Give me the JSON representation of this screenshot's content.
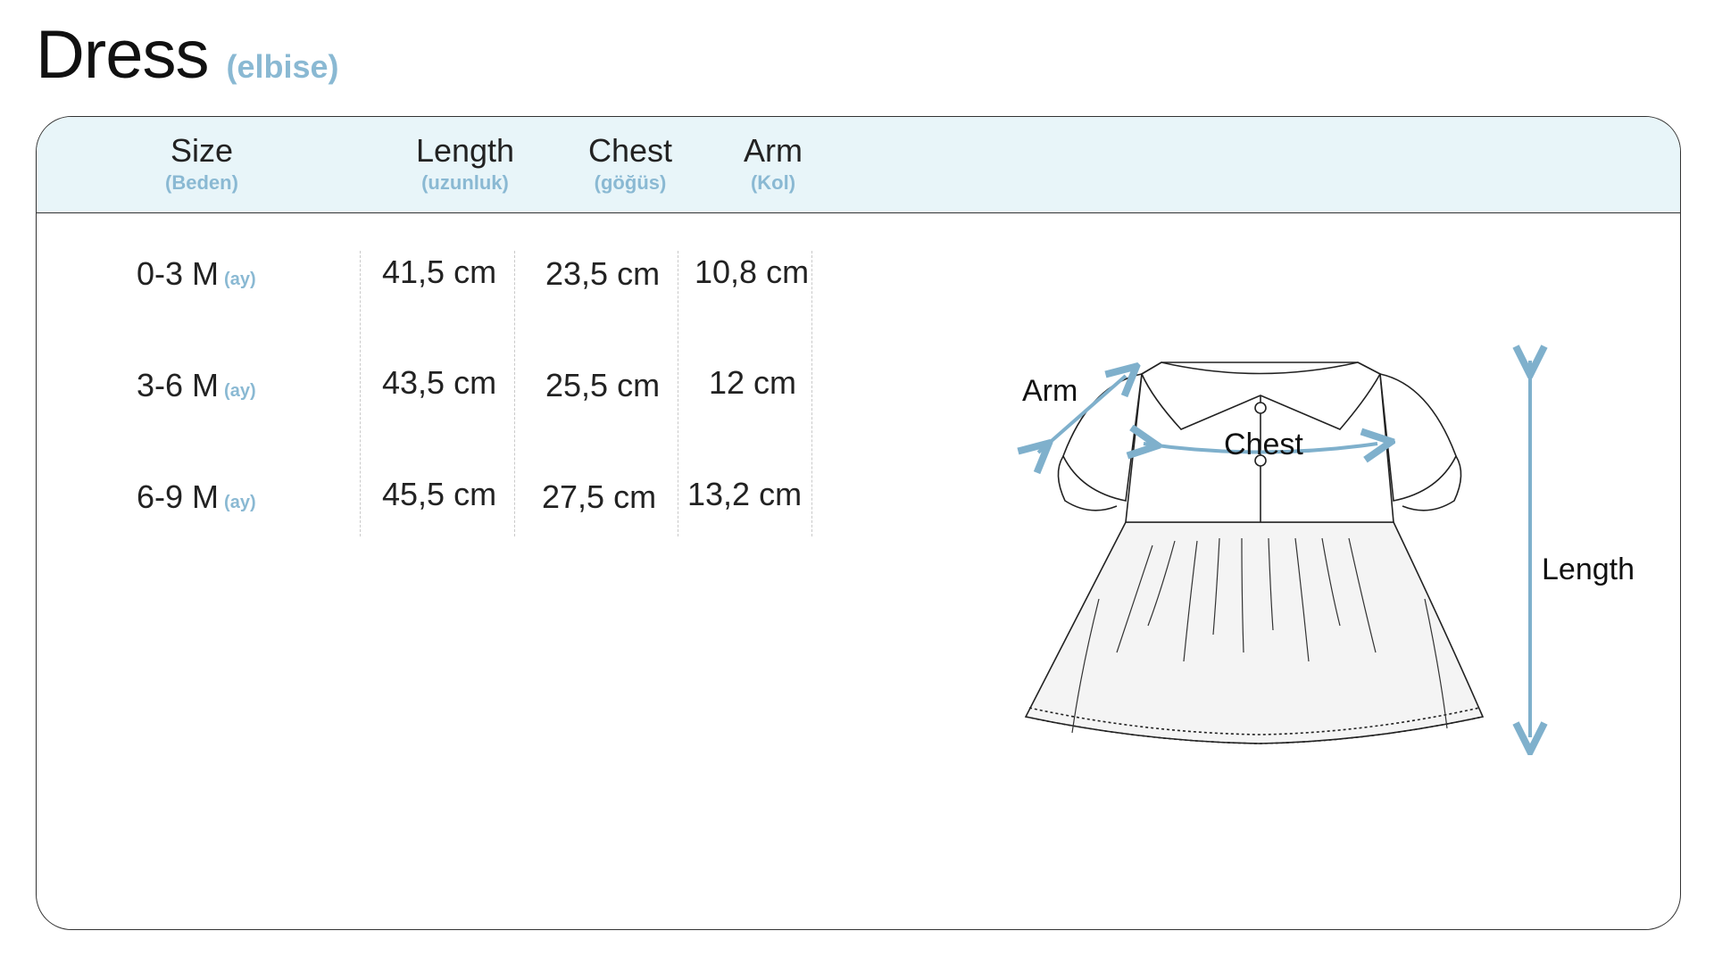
{
  "title": {
    "main": "Dress",
    "sub": "(elbise)"
  },
  "columns": [
    {
      "label": "Size",
      "sub": "(Beden)"
    },
    {
      "label": "Length",
      "sub": "(uzunluk)"
    },
    {
      "label": "Chest",
      "sub": "(göğüs)"
    },
    {
      "label": "Arm",
      "sub": "(Kol)"
    }
  ],
  "rows": [
    {
      "size": "0-3 M",
      "size_sub": "(ay)",
      "length": "41,5 cm",
      "chest": "23,5 cm",
      "arm": "10,8 cm"
    },
    {
      "size": "3-6 M",
      "size_sub": "(ay)",
      "length": "43,5 cm",
      "chest": "25,5 cm",
      "arm": "12 cm"
    },
    {
      "size": "6-9 M",
      "size_sub": "(ay)",
      "length": "45,5 cm",
      "chest": "27,5 cm",
      "arm": "13,2 cm"
    }
  ],
  "diagram": {
    "arm_label": "Arm",
    "chest_label": "Chest",
    "length_label": "Length"
  },
  "colors": {
    "accent": "#8ab9d3",
    "header_bg": "#e8f5f9",
    "arrow": "#7fb0cc"
  }
}
